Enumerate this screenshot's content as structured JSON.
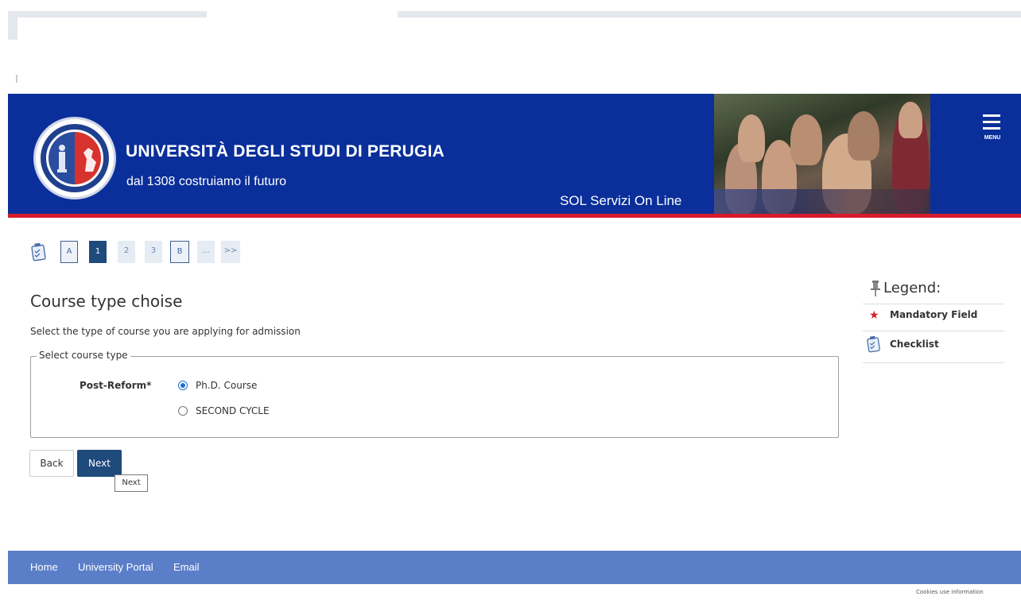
{
  "header": {
    "university_name": "UNIVERSITÀ DEGLI STUDI DI PERUGIA",
    "motto": "dal 1308 costruiamo il futuro",
    "service_name": "SOL Servizi On Line",
    "menu_label": "MENU"
  },
  "steps": [
    "A",
    "1",
    "2",
    "3",
    "B",
    "...",
    ">>"
  ],
  "main": {
    "title": "Course type choise",
    "description": "Select the type of course you are applying for admission",
    "fieldset_legend": "Select course type",
    "field_label": "Post-Reform*",
    "options": [
      {
        "label": "Ph.D. Course",
        "checked": true
      },
      {
        "label": "SECOND CYCLE",
        "checked": false
      }
    ]
  },
  "buttons": {
    "back": "Back",
    "next": "Next",
    "tooltip": "Next"
  },
  "legend": {
    "title": "Legend:",
    "mandatory": "Mandatory Field",
    "checklist": "Checklist"
  },
  "footer": {
    "links": [
      "Home",
      "University Portal",
      "Email"
    ],
    "cookies": "Cookies use information"
  },
  "colors": {
    "header_blue": "#0a2f9a",
    "accent_red": "#d61c2a",
    "button_blue": "#1e4a7c",
    "footer_blue": "#5b7ec8"
  }
}
